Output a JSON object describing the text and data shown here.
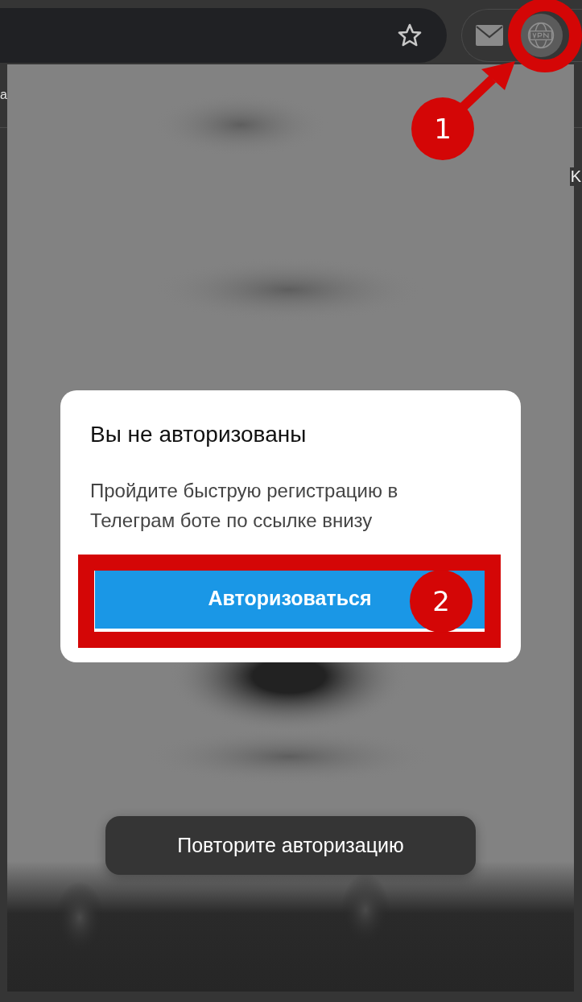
{
  "browser": {
    "edge_text_left": "a",
    "edge_text_right": "K"
  },
  "dialog": {
    "title": "Вы не авторизованы",
    "message": "Пройдите быструю регистрацию в Телеграм боте по ссылке внизу",
    "button": "Авторизоваться"
  },
  "toast": {
    "text": "Повторите авторизацию"
  },
  "annotations": [
    {
      "kind": "ring"
    },
    {
      "kind": "arrow"
    },
    {
      "kind": "badge",
      "label": "1"
    },
    {
      "kind": "frame"
    },
    {
      "kind": "badge",
      "label": "2"
    }
  ]
}
